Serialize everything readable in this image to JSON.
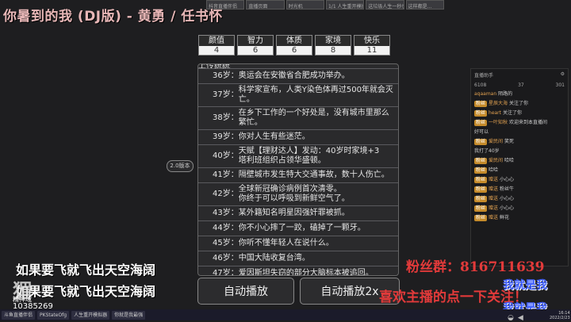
{
  "stream_title": "你暑到的我 (DJ版) - 黄勇 / 任书怀",
  "browser_tabs": [
    "抖音直播伴侣",
    "直播页面",
    "时光机",
    "1/1 人生重开模拟器",
    "这垃圾人生一秒也不想待了",
    "这样都是..."
  ],
  "stats": [
    {
      "label": "颜值",
      "value": "4"
    },
    {
      "label": "智力",
      "value": "6"
    },
    {
      "label": "体质",
      "value": "6"
    },
    {
      "label": "家境",
      "value": "8"
    },
    {
      "label": "快乐",
      "value": "11"
    }
  ],
  "events": [
    {
      "age": "",
      "text": "上传统统"
    },
    {
      "age": "36岁：",
      "text": "奥运会在安徽省合肥成功举办。"
    },
    {
      "age": "37岁：",
      "text": "科学家宣布，人类Y染色体再过500年就会灭亡。"
    },
    {
      "age": "38岁：",
      "text": "在乡下工作的一个好处是，没有城市里那么繁忙。"
    },
    {
      "age": "39岁：",
      "text": "你对人生有些迷茫。"
    },
    {
      "age": "40岁：",
      "text": "天赋【理财达人】发动：40岁时家境+3\n塔利班组织占领华盛顿。"
    },
    {
      "age": "41岁：",
      "text": "隔壁城市发生特大交通事故，数十人伤亡。"
    },
    {
      "age": "42岁：",
      "text": "全球新冠确诊病例首次清零。\n你终于可以呼吸到新鲜空气了。"
    },
    {
      "age": "43岁：",
      "text": "某外籍知名明星因强奸罪被抓。"
    },
    {
      "age": "44岁：",
      "text": "你不小心摔了一跤，磕掉了一颗牙。"
    },
    {
      "age": "45岁：",
      "text": "你听不懂年轻人在说什么。"
    },
    {
      "age": "46岁：",
      "text": "中国大陆收复台湾。"
    },
    {
      "age": "47岁：",
      "text": "爱因斯坦失窃的部分大脑标本被追回。"
    }
  ],
  "side_button": "2.0版本",
  "buttons": {
    "auto_play": "自动播放",
    "auto_play_2x": "自动播放2x"
  },
  "lyrics": [
    "如果要飞就飞出天空海阔",
    "如果要飞就飞出天空海阔"
  ],
  "logo": {
    "mark": "猸",
    "sub": "精神域",
    "room": "10385269"
  },
  "overlay": {
    "fans": "粉丝群：816711639",
    "like": "喜欢主播的点一下关注！",
    "me1": "我就是我",
    "me2": "我就是我"
  },
  "chat": {
    "header": "直播助手",
    "counts": [
      "6108",
      "37",
      "301"
    ],
    "messages": [
      {
        "badge": "",
        "name": "aqaaman",
        "text": "陌路的"
      },
      {
        "badge": "粉丝",
        "name": "星辰大海",
        "text": "关注了你"
      },
      {
        "badge": "粉丝",
        "name": "heart",
        "text": "关注了你"
      },
      {
        "badge": "粉丝",
        "name": "一叶知秋",
        "text": "欢迎来到本直播间"
      },
      {
        "badge": "",
        "name": "",
        "text": "好可以"
      },
      {
        "badge": "粉丝",
        "name": "爱民间",
        "text": "笑死"
      },
      {
        "badge": "",
        "name": "",
        "text": "我打了40岁"
      },
      {
        "badge": "粉丝",
        "name": "爱民间",
        "text": "哈哈"
      },
      {
        "badge": "粉丝",
        "name": "",
        "text": "哈哈"
      },
      {
        "badge": "粉丝",
        "name": "赠送",
        "text": "小心心"
      },
      {
        "badge": "粉丝",
        "name": "赠送",
        "text": "粉丝牛"
      },
      {
        "badge": "粉丝",
        "name": "赠送",
        "text": "小心心"
      },
      {
        "badge": "粉丝",
        "name": "赠送",
        "text": "小心心"
      },
      {
        "badge": "粉丝",
        "name": "赠送",
        "text": "鲜花"
      }
    ]
  },
  "taskbar": {
    "items": [
      "斗鱼直播伴侣",
      "PKStateOfg",
      "人生重开模拟器",
      "你就是我最强"
    ],
    "time": "16:14",
    "date": "2022/2/23"
  }
}
